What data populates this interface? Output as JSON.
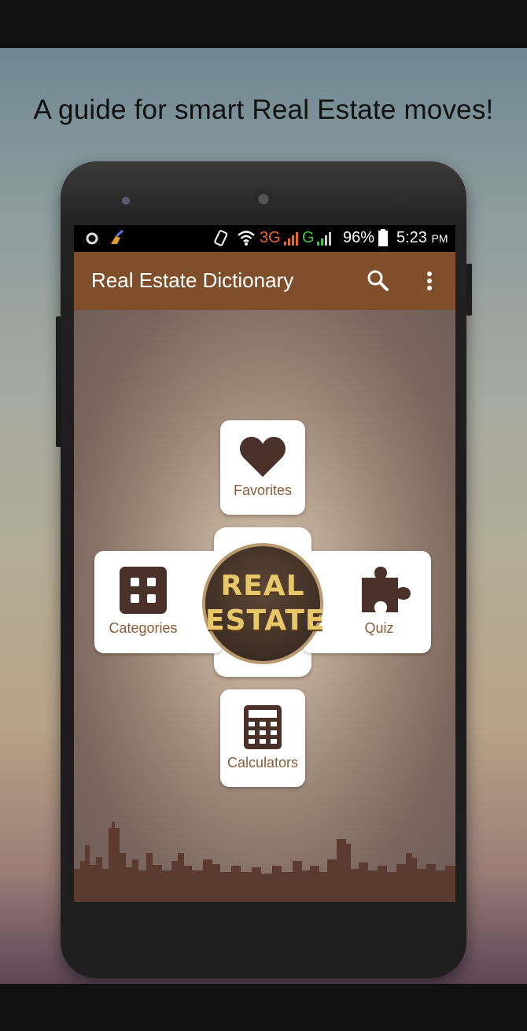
{
  "headline": "A guide for smart Real Estate moves!",
  "status_bar": {
    "network_3g": "3G",
    "network_g": "G",
    "battery": "96%",
    "time": "5:23",
    "ampm": "PM"
  },
  "app_bar": {
    "title": "Real Estate Dictionary",
    "icons": [
      "search-icon",
      "more-vert-icon"
    ]
  },
  "menu": {
    "favorites": "Favorites",
    "categories": "Categories",
    "quiz": "Quiz",
    "calculators": "Calculators"
  },
  "logo": {
    "line1": "REAL",
    "line2": "ESTATE"
  },
  "colors": {
    "app_bar": "#7e4f2a",
    "icon_dark": "#4a322a",
    "label": "#8a5c36",
    "logo_gold": "#e8c76a"
  }
}
